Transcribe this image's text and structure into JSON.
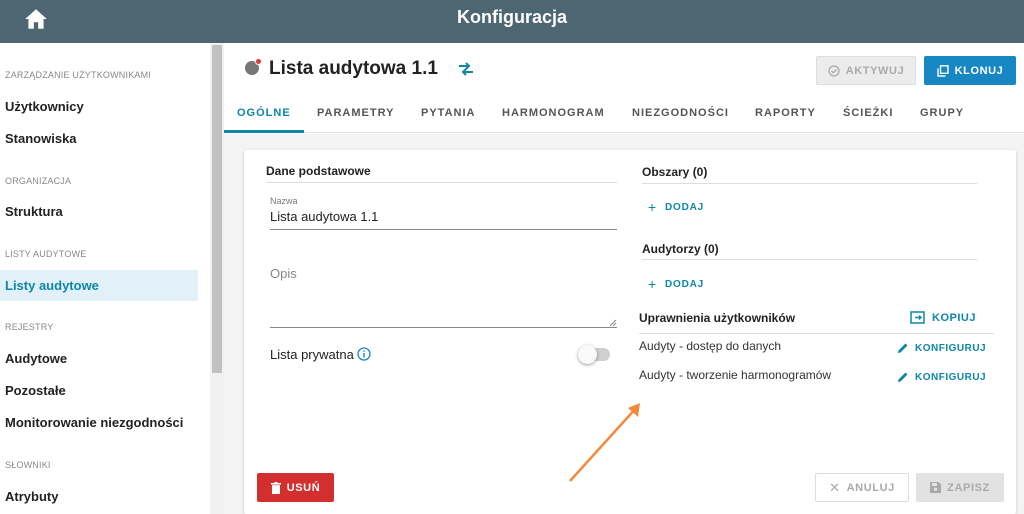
{
  "app": {
    "title": "Konfiguracja"
  },
  "sidebar": {
    "sections": [
      {
        "label": "ZARZĄDZANIE UŻYTKOWNIKAMI",
        "items": [
          "Użytkownicy",
          "Stanowiska"
        ]
      },
      {
        "label": "ORGANIZACJA",
        "items": [
          "Struktura"
        ]
      },
      {
        "label": "LISTY AUDYTOWE",
        "items": [
          "Listy audytowe"
        ]
      },
      {
        "label": "REJESTRY",
        "items": [
          "Audytowe",
          "Pozostałe",
          "Monitorowanie niezgodności"
        ]
      },
      {
        "label": "SŁOWNIKI",
        "items": [
          "Atrybuty"
        ]
      }
    ],
    "active_item": "Listy audytowe"
  },
  "header": {
    "title": "Lista audytowa 1.1",
    "aktywuj_label": "AKTYWUJ",
    "klonuj_label": "KLONUJ"
  },
  "tabs": [
    "OGÓLNE",
    "PARAMETRY",
    "PYTANIA",
    "HARMONOGRAM",
    "NIEZGODNOŚCI",
    "RAPORTY",
    "ŚCIEŻKI",
    "GRUPY"
  ],
  "active_tab": "OGÓLNE",
  "form": {
    "section_title": "Dane podstawowe",
    "name_label": "Nazwa",
    "name_value": "Lista audytowa 1.1",
    "description_placeholder": "Opis",
    "private_label": "Lista prywatna",
    "private_value": false
  },
  "areas": {
    "title": "Obszary (0)",
    "add_label": "DODAJ"
  },
  "auditors": {
    "title": "Audytorzy (0)",
    "add_label": "DODAJ"
  },
  "permissions": {
    "title": "Uprawnienia użytkowników",
    "copy_label": "KOPIUJ",
    "rows": [
      {
        "label": "Audyty - dostęp do danych",
        "action": "KONFIGURUJ"
      },
      {
        "label": "Audyty - tworzenie harmonogramów",
        "action": "KONFIGURUJ"
      }
    ]
  },
  "footer": {
    "delete_label": "USUŃ",
    "cancel_label": "ANULUJ",
    "save_label": "ZAPISZ"
  },
  "colors": {
    "topbar": "#4d6671",
    "accent": "#0d86a8",
    "primary_button": "#1787c3",
    "danger": "#d32f2f",
    "annotation_arrow": "#f08a3c"
  }
}
